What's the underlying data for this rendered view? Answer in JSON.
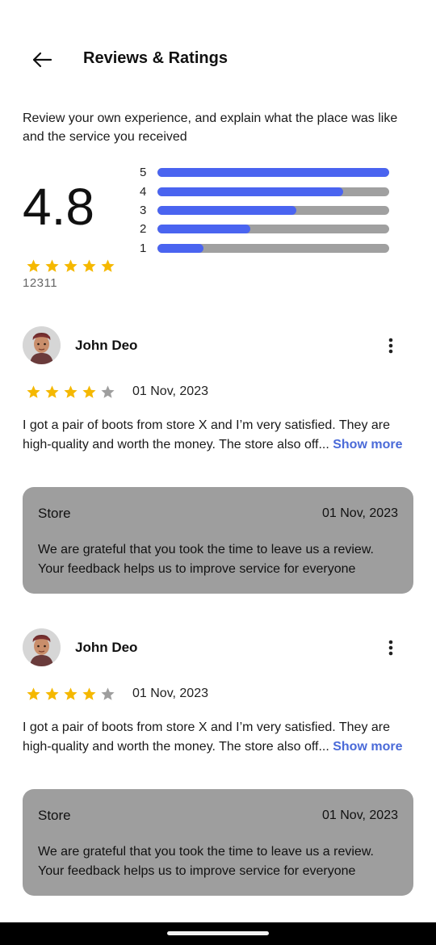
{
  "header": {
    "back_icon": "arrow-left-icon",
    "title": "Reviews & Ratings"
  },
  "intro": "Review your own experience, and explain what the place was like and the service you received",
  "summary": {
    "score": "4.8",
    "stars": 5,
    "review_count": "12311",
    "bars": [
      {
        "label": "5",
        "fraction": 1.0
      },
      {
        "label": "4",
        "fraction": 0.8
      },
      {
        "label": "3",
        "fraction": 0.6
      },
      {
        "label": "2",
        "fraction": 0.4
      },
      {
        "label": "1",
        "fraction": 0.2
      }
    ]
  },
  "colors": {
    "star_filled": "#f5b800",
    "star_empty": "#9e9e9e",
    "bar_fill": "#4a64f0",
    "bar_track": "#a0a0a0",
    "link": "#4a6ad8",
    "reply_bg": "#9e9e9e"
  },
  "reviews": [
    {
      "name": "John Deo",
      "rating": 4,
      "date": "01 Nov, 2023",
      "text": "I got a pair of boots from store X and I’m very satisfied. They are high-quality and worth the money. The store also off...",
      "show_more": "Show more",
      "menu_icon": "more-vertical-icon",
      "reply": {
        "from": "Store",
        "date": "01 Nov, 2023",
        "text": "We are grateful that you took the time to leave us a review. Your feedback helps us to improve service for everyone"
      }
    },
    {
      "name": "John Deo",
      "rating": 4,
      "date": "01 Nov, 2023",
      "text": "I got a pair of boots from store X and I’m very satisfied. They are high-quality and worth the money. The store also off...",
      "show_more": "Show more",
      "menu_icon": "more-vertical-icon",
      "reply": {
        "from": "Store",
        "date": "01 Nov, 2023",
        "text": "We are grateful that you took the time to leave us a review. Your feedback helps us to improve service for everyone"
      }
    }
  ]
}
